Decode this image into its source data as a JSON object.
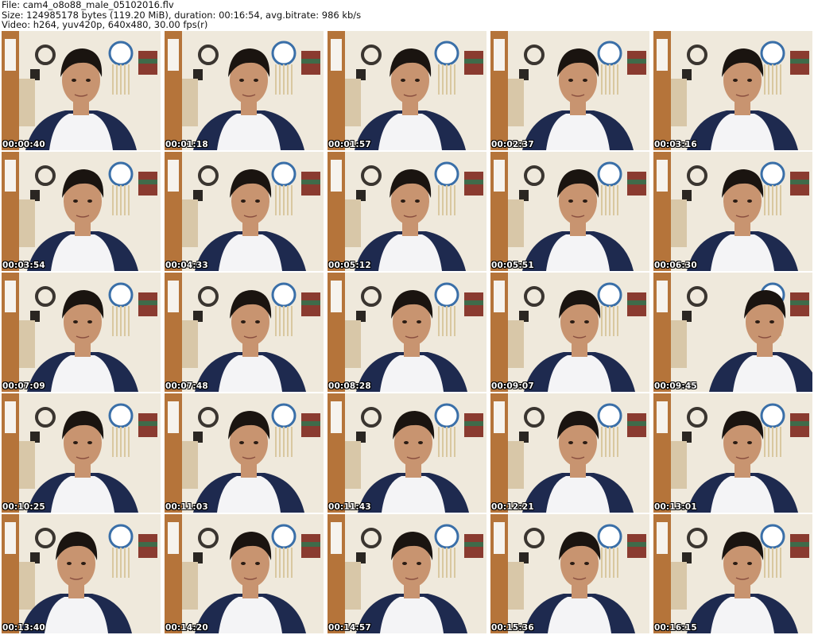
{
  "header": {
    "file_line": "File: cam4_o8o88_male_05102016.flv",
    "size_line": "Size: 124985178 bytes (119.20 MiB), duration: 00:16:54, avg.bitrate: 986 kb/s",
    "video_line": "Video: h264, yuv420p, 640x480, 30.00 fps(r)"
  },
  "thumbnails": [
    {
      "timestamp": "00:00:40"
    },
    {
      "timestamp": "00:01:18"
    },
    {
      "timestamp": "00:01:57"
    },
    {
      "timestamp": "00:02:37"
    },
    {
      "timestamp": "00:03:16"
    },
    {
      "timestamp": "00:03:54"
    },
    {
      "timestamp": "00:04:33"
    },
    {
      "timestamp": "00:05:12"
    },
    {
      "timestamp": "00:05:51"
    },
    {
      "timestamp": "00:06:30"
    },
    {
      "timestamp": "00:07:09"
    },
    {
      "timestamp": "00:07:48"
    },
    {
      "timestamp": "00:08:28"
    },
    {
      "timestamp": "00:09:07"
    },
    {
      "timestamp": "00:09:45"
    },
    {
      "timestamp": "00:10:25"
    },
    {
      "timestamp": "00:11:03"
    },
    {
      "timestamp": "00:11:43"
    },
    {
      "timestamp": "00:12:21"
    },
    {
      "timestamp": "00:13:01"
    },
    {
      "timestamp": "00:13:40"
    },
    {
      "timestamp": "00:14:20"
    },
    {
      "timestamp": "00:14:57"
    },
    {
      "timestamp": "00:15:36"
    },
    {
      "timestamp": "00:16:15"
    }
  ],
  "colors": {
    "wall": "#efe9dc",
    "door": "#b5743a",
    "shirt_sleeve": "#1e2a4f",
    "shirt_body": "#f4f4f6",
    "skin": "#c89470",
    "hair": "#1a1410"
  }
}
